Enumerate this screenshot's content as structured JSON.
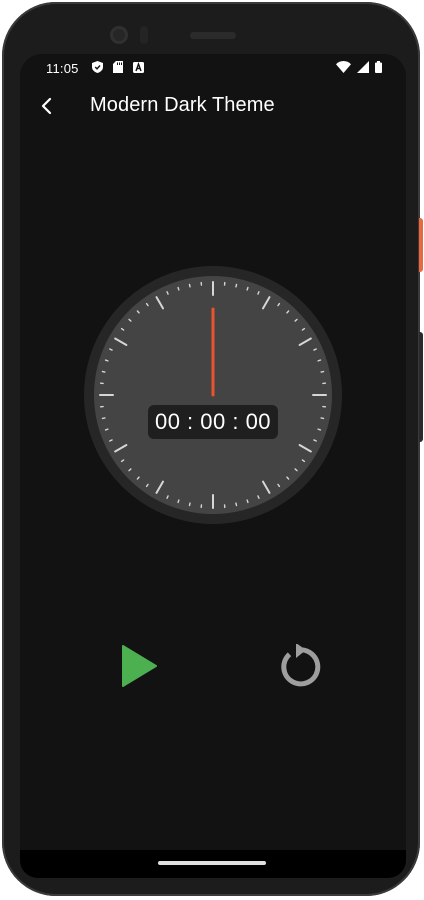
{
  "status_bar": {
    "time": "11:05",
    "left_icons": [
      "shield-icon",
      "sd-card-icon",
      "a-badge-icon"
    ],
    "right_icons": [
      "wifi-icon",
      "cell-signal-icon",
      "battery-icon"
    ]
  },
  "app_bar": {
    "back_icon": "back-arrow-icon",
    "title": "Modern Dark Theme"
  },
  "stopwatch": {
    "display": "00 : 00 : 00",
    "hand_position_seconds": 0,
    "colors": {
      "face": "#444444",
      "bezel": "#262626",
      "hand": "#e8542d",
      "ticks": "#d6d6d6"
    }
  },
  "controls": {
    "play_icon": "play-icon",
    "play_color": "#4caf50",
    "reset_icon": "reset-icon",
    "reset_color": "#9e9e9e"
  },
  "colors": {
    "background": "#121212",
    "text": "#ffffff",
    "device_side_button": "#e8693f"
  }
}
